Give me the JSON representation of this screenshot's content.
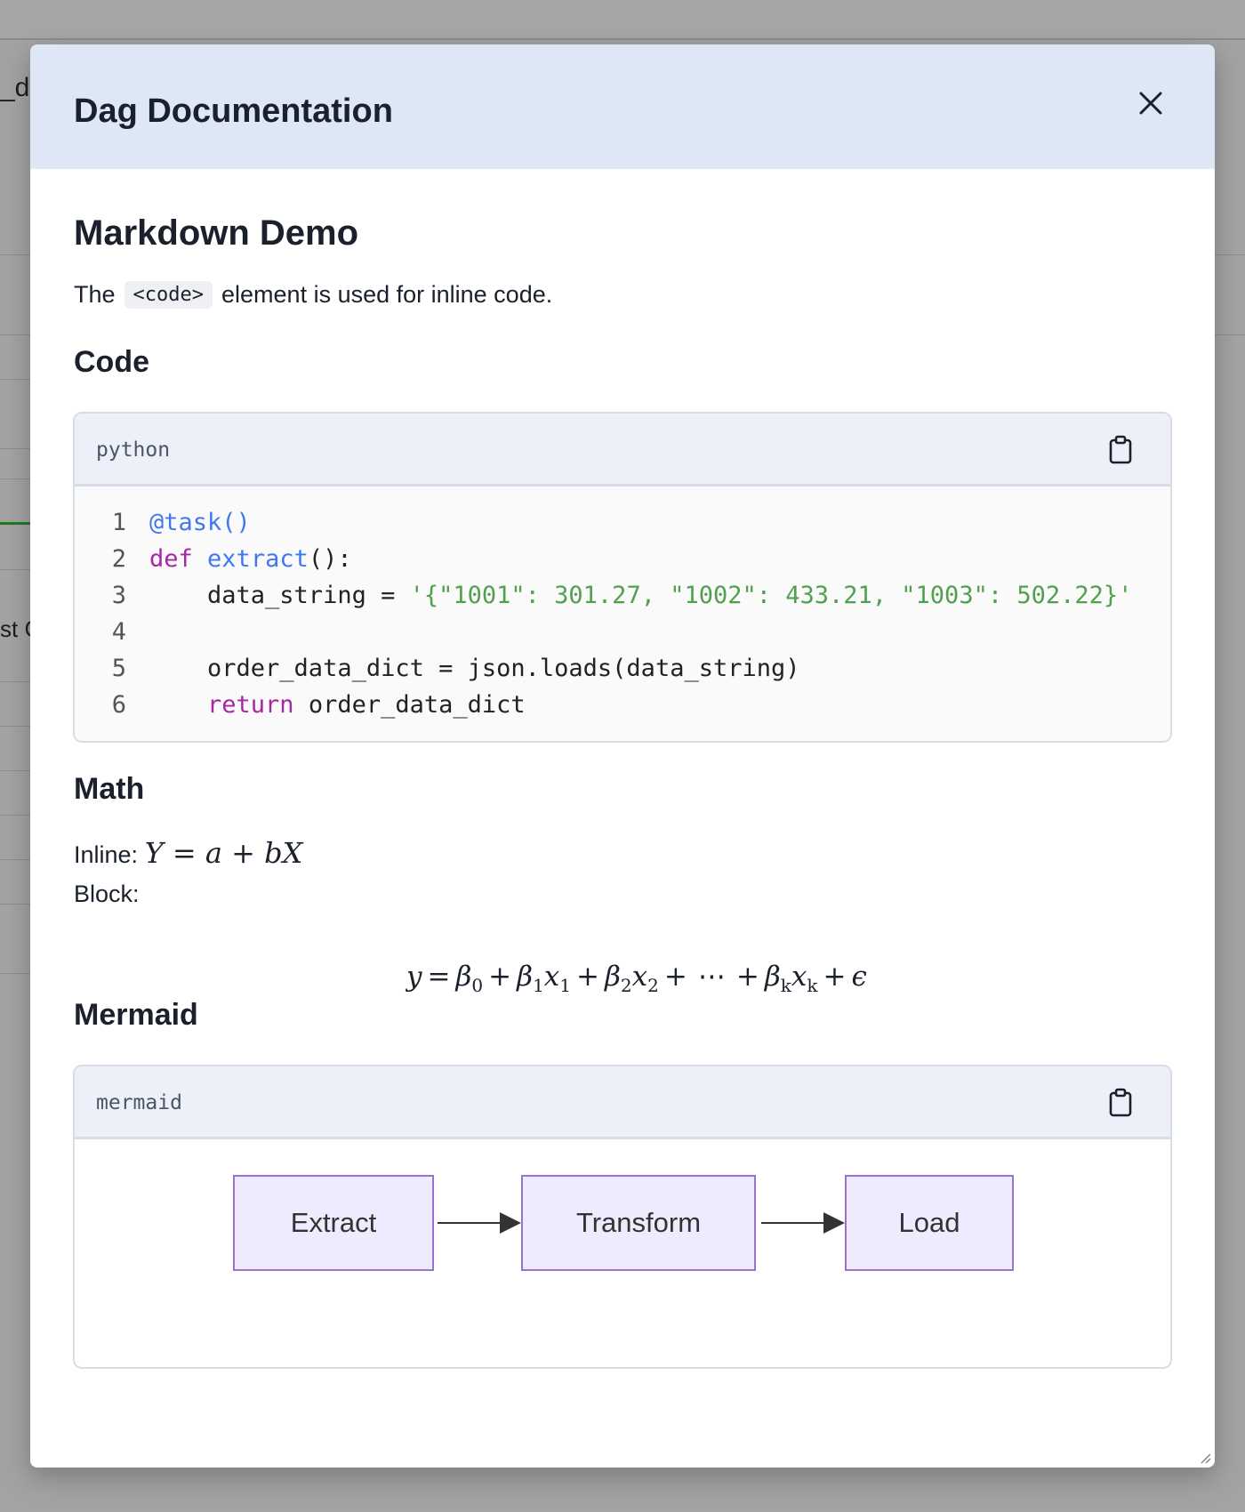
{
  "background": {
    "fragment_top": "_d",
    "fragment_mid": "st C"
  },
  "modal": {
    "title": "Dag Documentation",
    "close_icon": "close-icon"
  },
  "doc": {
    "heading": "Markdown Demo",
    "paragraph": {
      "before": "The",
      "inline_code": "<code>",
      "after": "element is used for inline code."
    },
    "code_section": {
      "heading": "Code",
      "language": "python",
      "copy_icon": "clipboard-icon",
      "line_numbers": [
        "1",
        "2",
        "3",
        "4",
        "5",
        "6"
      ]
    },
    "math_section": {
      "heading": "Math",
      "inline_label": "Inline:",
      "inline_formula": "Y = a + bX",
      "block_label": "Block:"
    },
    "mermaid_section": {
      "heading": "Mermaid",
      "language": "mermaid",
      "copy_icon": "clipboard-icon",
      "nodes": [
        "Extract",
        "Transform",
        "Load"
      ]
    }
  }
}
